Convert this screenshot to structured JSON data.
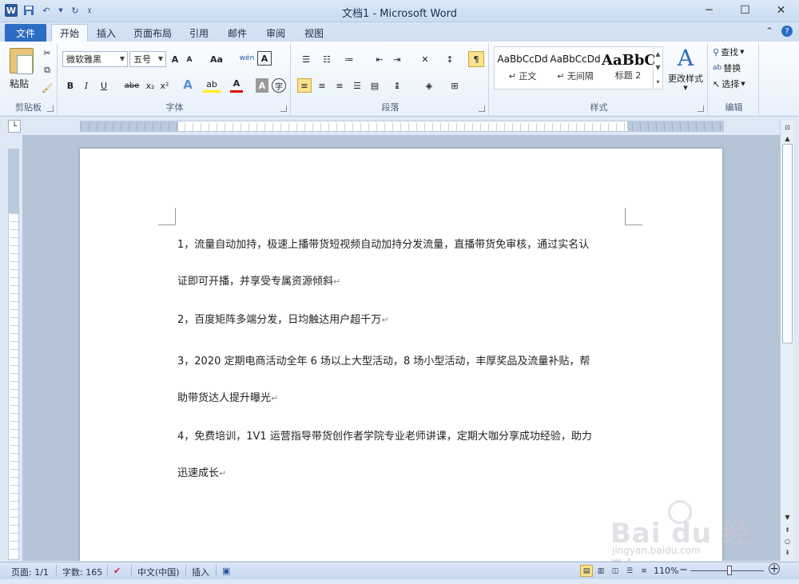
{
  "app": {
    "title": "文档1 - Microsoft Word",
    "logo_letter": "W"
  },
  "window": {
    "minimize": "─",
    "maximize": "☐",
    "close": "✕"
  },
  "quick_access": {
    "save_icon": "save-icon",
    "undo_icon": "undo-icon",
    "redo_icon": "redo-icon",
    "customize_icon": "customize-icon"
  },
  "tabs": {
    "file": "文件",
    "items": [
      "开始",
      "插入",
      "页面布局",
      "引用",
      "邮件",
      "审阅",
      "视图"
    ],
    "active_index": 0
  },
  "ribbon": {
    "clipboard": {
      "label": "剪贴板",
      "paste": "粘贴"
    },
    "font": {
      "label": "字体",
      "font_name": "微软雅黑",
      "font_size": "五号",
      "grow": "A",
      "shrink": "A",
      "case": "Aa",
      "phonetic": "wén",
      "char_border": "A",
      "bold": "B",
      "italic": "I",
      "underline": "U",
      "strike": "abe",
      "subscript": "x₂",
      "superscript": "x²",
      "text_effect": "A",
      "highlight": "ab",
      "font_color": "A",
      "char_shading": "A",
      "enclose": "字"
    },
    "paragraph": {
      "label": "段落"
    },
    "styles": {
      "label": "样式",
      "items": [
        {
          "preview": "AaBbCcDd",
          "name": "↵ 正文"
        },
        {
          "preview": "AaBbCcDd",
          "name": "↵ 无间隔"
        },
        {
          "preview": "AaBbC",
          "name": "标题 2"
        }
      ],
      "change_styles": "更改样式",
      "change_styles_icon": "A"
    },
    "editing": {
      "label": "编辑",
      "find": "查找",
      "replace": "替换",
      "select": "选择"
    }
  },
  "document": {
    "paragraphs": [
      [
        "1，流量自动加持，极速上播带货短视频自动加持分发流量，直播带货免审核，通过实名认",
        "证即可开播，并享受专属资源倾斜"
      ],
      [
        "2，百度矩阵多端分发，日均触达用户超千万"
      ],
      [
        "3，2020 定期电商活动全年 6 场以上大型活动，8 场小型活动，丰厚奖品及流量补贴，帮",
        "助带货达人提升曝光"
      ],
      [
        "4，免费培训，1V1 运营指导带货创作者学院专业老师讲课，定期大咖分享成功经验，助力",
        "迅速成长"
      ]
    ],
    "paragraph_mark": "↵"
  },
  "statusbar": {
    "page": "页面: 1/1",
    "words": "字数: 165",
    "language": "中文(中国)",
    "mode": "插入",
    "zoom": "110%",
    "zoom_out": "−",
    "zoom_in": "+"
  },
  "watermark": {
    "main": "Bai du 经验",
    "sub": "jingyan.baidu.com"
  },
  "colors": {
    "accent": "#2b579a",
    "file_tab": "#2b6cc4",
    "ribbon_bg": "#e8f0fa",
    "page_bg": "#b6c4d8"
  }
}
